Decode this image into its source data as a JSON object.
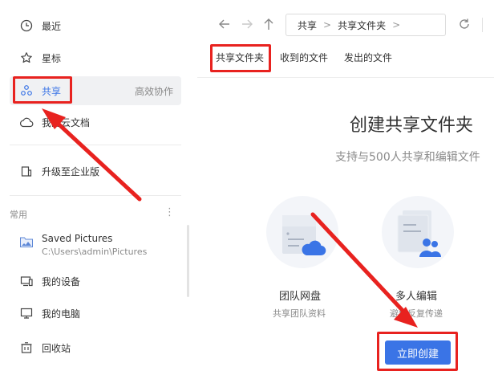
{
  "sidebar": {
    "recent_label": "最近",
    "starred_label": "星标",
    "shared_label": "共享",
    "shared_tail": "高效协作",
    "cloud_docs_label": "我的云文档",
    "upgrade_label": "升级至企业版",
    "common_title": "常用",
    "more_glyph": "⋮",
    "saved_pictures": {
      "title": "Saved Pictures",
      "path": "C:\\Users\\admin\\Pictures"
    },
    "my_device_label": "我的设备",
    "my_computer_label": "我的电脑",
    "recycle_bin_label": "回收站"
  },
  "toolbar": {
    "breadcrumb": [
      "共享",
      "共享文件夹"
    ],
    "breadcrumb_sep": ">"
  },
  "tabs": [
    "共享文件夹",
    "收到的文件",
    "发出的文件"
  ],
  "hero": {
    "title": "创建共享文件夹",
    "subtitle": "支持与500人共享和编辑文件"
  },
  "features": [
    {
      "title": "团队网盘",
      "desc": "共享团队资料"
    },
    {
      "title": "多人编辑",
      "desc": "避免反复传递"
    }
  ],
  "cta_label": "立即创建",
  "colors": {
    "accent": "#3a74e6",
    "annotation": "#e8221f"
  }
}
